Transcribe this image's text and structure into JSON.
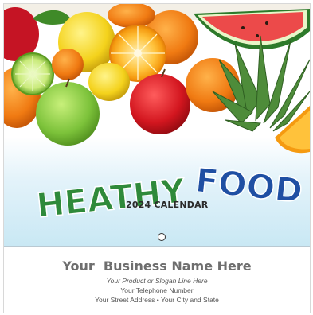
{
  "cover": {
    "title_word1": "HEATHY",
    "title_word2": "FOOD",
    "subtitle": "2024 CALENDAR",
    "colors": {
      "title_green": "#2f8a3a",
      "title_blue": "#1f4fa3",
      "sky_bottom": "#c9e8f4"
    },
    "image_subject": "fruit-arrangement"
  },
  "imprint": {
    "business_name": "Your  Business Name Here",
    "slogan": "Your Product or Slogan Line Here",
    "phone": "Your Telephone Number",
    "address": "Your Street Address • Your City and State"
  }
}
